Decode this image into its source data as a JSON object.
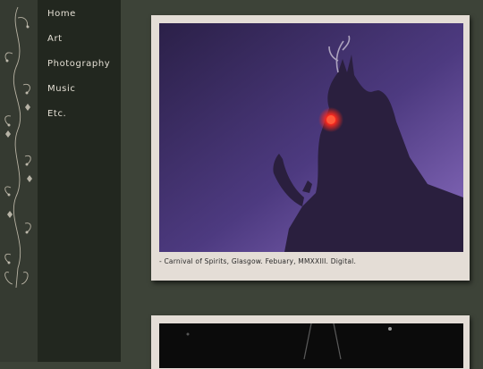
{
  "nav": {
    "items": [
      "Home",
      "Art",
      "Photography",
      "Music",
      "Etc."
    ]
  },
  "gallery": {
    "posts": [
      {
        "caption": "- Carnival of Spirits, Glasgow. Febuary, MMXXIII. Digital.",
        "image": "photo-of-costumed-figure-with-antlers-and-glowing-red-eye"
      },
      {
        "caption": "",
        "image": "dark-photo"
      }
    ]
  },
  "colors": {
    "background": "#3d4338",
    "sidebar": "#22271f",
    "card": "#e4ddd6",
    "nav_text": "#e4dfd4",
    "accent_red": "#ff2a1e"
  }
}
